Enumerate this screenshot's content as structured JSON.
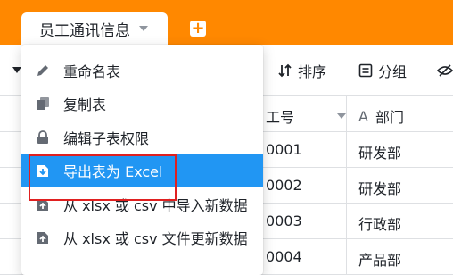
{
  "header": {
    "sheet_tab_label": "员工通讯信息",
    "add_sheet_symbol": "+",
    "colors": {
      "header_bg": "#ff8800",
      "menu_active_bg": "#2196f3",
      "highlight_border": "#e02020"
    }
  },
  "toolbar": {
    "sort_label": "排序",
    "group_label": "分组",
    "sort_icon": "sort-icon",
    "group_icon": "group-icon",
    "hide_icon": "hide-icon"
  },
  "grid": {
    "columns": [
      {
        "label": "工号",
        "icon": "number-icon"
      },
      {
        "label": "部门",
        "icon": "text-type-icon",
        "icon_glyph": "A"
      }
    ],
    "rows": [
      {
        "id": "0001",
        "dept": "研发部"
      },
      {
        "id": "0002",
        "dept": "研发部"
      },
      {
        "id": "0003",
        "dept": "行政部"
      },
      {
        "id": "0004",
        "dept": "产品部"
      }
    ]
  },
  "menu": {
    "items": [
      {
        "label": "重命名表",
        "icon": "rename-pen-icon"
      },
      {
        "label": "复制表",
        "icon": "copy-icon"
      },
      {
        "label": "编辑子表权限",
        "icon": "lock-permission-icon"
      },
      {
        "label": "导出表为 Excel",
        "icon": "export-download-icon",
        "active": true
      },
      {
        "label": "从 xlsx 或 csv 中导入新数据",
        "icon": "import-upload-icon"
      },
      {
        "label": "从 xlsx 或 csv 文件更新数据",
        "icon": "update-upload-icon"
      }
    ]
  }
}
